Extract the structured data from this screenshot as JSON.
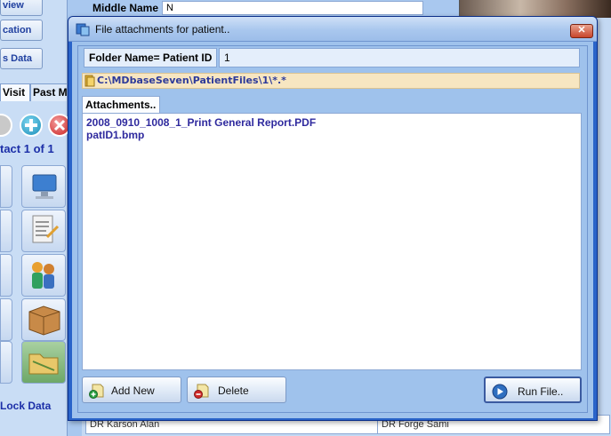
{
  "background": {
    "left_buttons": [
      {
        "label": "view"
      },
      {
        "label": "cation"
      },
      {
        "label": "s Data"
      }
    ],
    "tabs": [
      {
        "label": "Visit",
        "active": true
      },
      {
        "label": "Past M",
        "active": false
      }
    ],
    "contact_counter": "tact 1 of 1",
    "lock_data_label": "Lock Data",
    "middle_name_label": "Middle Name",
    "middle_name_value": "N",
    "bottom_doctor_left": "DR Karson Alan",
    "bottom_doctor_right": "DR Forge Sami"
  },
  "dialog": {
    "title": "File attachments for patient..",
    "close_label": "✕",
    "folder_label": "Folder Name= Patient ID",
    "folder_value": "1",
    "path": "C:\\MDbaseSeven\\PatientFiles\\1\\*.*",
    "attachments_tab": "Attachments..",
    "attachments": [
      "2008_0910_1008_1_Print General Report.PDF",
      "patID1.bmp"
    ],
    "buttons": {
      "add": "Add New",
      "delete": "Delete",
      "run": "Run File.."
    }
  },
  "colors": {
    "accent_title": "#2a64c9",
    "list_text": "#2f2a9e",
    "path_bg": "#f7e6c1"
  }
}
